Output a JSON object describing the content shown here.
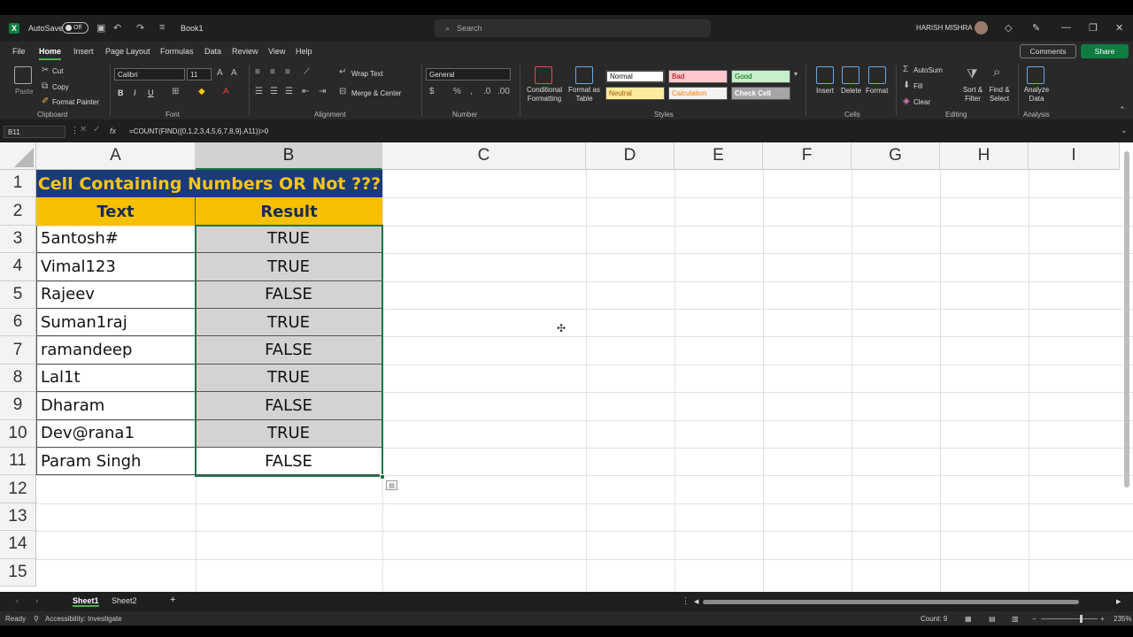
{
  "titlebar": {
    "autosave_label": "AutoSave",
    "autosave_state": "Off",
    "doc_name": "Book1",
    "search_placeholder": "Search",
    "user_name": "HARISH MISHRA"
  },
  "tabs": [
    "File",
    "Home",
    "Insert",
    "Page Layout",
    "Formulas",
    "Data",
    "Review",
    "View",
    "Help"
  ],
  "active_tab": "Home",
  "buttons": {
    "comments": "Comments",
    "share": "Share"
  },
  "ribbon": {
    "clipboard": {
      "paste": "Paste",
      "cut": "Cut",
      "copy": "Copy",
      "format_painter": "Format Painter",
      "label": "Clipboard"
    },
    "font": {
      "name": "Calibri",
      "size": "11",
      "bold": "B",
      "italic": "I",
      "underline": "U",
      "label": "Font"
    },
    "alignment": {
      "wrap": "Wrap Text",
      "merge": "Merge & Center",
      "label": "Alignment"
    },
    "number": {
      "format": "General",
      "label": "Number"
    },
    "styles": {
      "conditional": "Conditional Formatting",
      "format_table": "Format as Table",
      "normal": "Normal",
      "bad": "Bad",
      "good": "Good",
      "neutral": "Neutral",
      "calculation": "Calculation",
      "check_cell": "Check Cell",
      "label": "Styles"
    },
    "cells": {
      "insert": "Insert",
      "delete": "Delete",
      "format": "Format",
      "label": "Cells"
    },
    "editing": {
      "autosum": "AutoSum",
      "fill": "Fill",
      "clear": "Clear",
      "sort": "Sort & Filter",
      "find": "Find & Select",
      "label": "Editing"
    },
    "analysis": {
      "analyze": "Analyze Data",
      "label": "Analysis"
    }
  },
  "formula_bar": {
    "name_box": "B11",
    "fx": "fx",
    "formula": "=COUNT(FIND({0,1,2,3,4,5,6,7,8,9},A11))>0"
  },
  "columns": [
    "A",
    "B",
    "C",
    "D",
    "E",
    "F",
    "G",
    "H",
    "I"
  ],
  "rows": [
    "1",
    "2",
    "3",
    "4",
    "5",
    "6",
    "7",
    "8",
    "9",
    "10",
    "11",
    "12",
    "13",
    "14",
    "15"
  ],
  "sheet": {
    "title": "Cell Containing Numbers OR Not ???",
    "header_text": "Text",
    "header_result": "Result",
    "data": [
      {
        "text": "5antosh#",
        "result": "TRUE"
      },
      {
        "text": "Vimal123",
        "result": "TRUE"
      },
      {
        "text": "Rajeev",
        "result": "FALSE"
      },
      {
        "text": "Suman1raj",
        "result": "TRUE"
      },
      {
        "text": "ramandeep",
        "result": "FALSE"
      },
      {
        "text": "Lal1t",
        "result": "TRUE"
      },
      {
        "text": "Dharam",
        "result": "FALSE"
      },
      {
        "text": "Dev@rana1",
        "result": "TRUE"
      },
      {
        "text": "Param Singh",
        "result": "FALSE"
      }
    ]
  },
  "sheet_tabs": [
    "Sheet1",
    "Sheet2"
  ],
  "statusbar": {
    "ready": "Ready",
    "accessibility": "Accessibility: Investigate",
    "count": "Count: 9",
    "zoom": "235%"
  },
  "colors": {
    "accent": "#107c41",
    "title_bg": "#1b3a7a",
    "title_fg": "#f5c518",
    "header_bg": "#f5c000",
    "result_bg": "#d3d3d3"
  }
}
